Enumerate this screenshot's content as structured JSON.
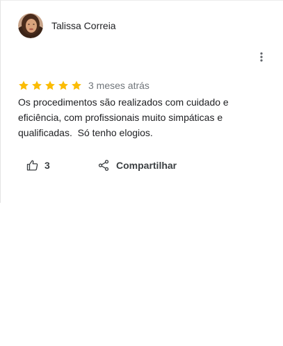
{
  "review": {
    "reviewer_name": "Talissa Correia",
    "avatar_icon": "reviewer-avatar",
    "menu_icon": "more-vertical-icon",
    "rating": 5,
    "rating_max": 5,
    "star_color": "#fbbc04",
    "date": "3 meses atrás",
    "text_lines": [
      "Os procedimentos são realizados com cuidado e",
      "eficiência, com profissionais muito simpáticas e",
      "qualificadas.  Só tenho elogios."
    ]
  },
  "actions": {
    "like_icon": "thumbs-up-icon",
    "like_count": "3",
    "share_icon": "share-icon",
    "share_label": "Compartilhar"
  }
}
